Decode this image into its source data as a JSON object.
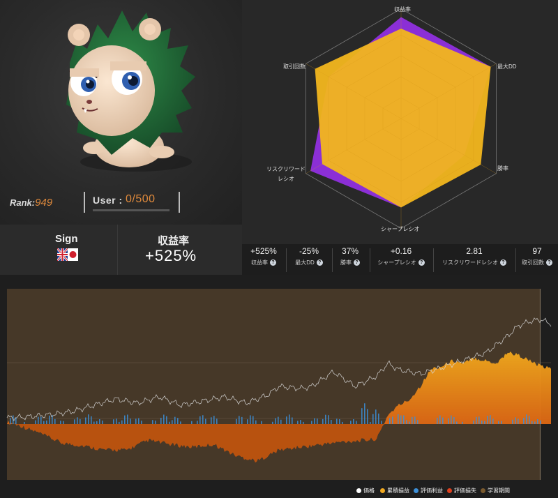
{
  "profile": {
    "rank_label": "Rank:",
    "rank_value": "949",
    "user_label": "User :",
    "user_value": "0/500",
    "avatar_icon": "lion-mascot-icon"
  },
  "sign": {
    "label": "Sign",
    "flag_icon": "gbp-jpy-flag-icon",
    "return_label": "収益率",
    "return_value": "+525%"
  },
  "radar": {
    "labels": [
      "収益率",
      "最大DD",
      "勝率",
      "シャープレシオ",
      "リスクリワードレシオ",
      "取引回数"
    ],
    "risk_reward_line1": "リスクリワード",
    "risk_reward_line2": "レシオ",
    "outer_values": [
      0.97,
      0.99,
      0.7,
      0.85,
      1.0,
      0.8
    ],
    "inner_values": [
      0.86,
      0.99,
      0.88,
      0.85,
      0.87,
      0.95
    ],
    "colors": {
      "outer": "#8b2fd6",
      "inner": "#f2b61e"
    }
  },
  "stats": [
    {
      "value": "+525%",
      "label": "収益率"
    },
    {
      "value": "-25%",
      "label": "最大DD"
    },
    {
      "value": "37%",
      "label": "勝率"
    },
    {
      "value": "+0.16",
      "label": "シャープレシオ"
    },
    {
      "value": "2.81",
      "label": "リスクリワードレシオ"
    },
    {
      "value": "97",
      "label": "取引回数"
    }
  ],
  "legend": [
    {
      "label": "価格",
      "color": "#ffffff"
    },
    {
      "label": "累積損益",
      "color": "#f0a820"
    },
    {
      "label": "評価利益",
      "color": "#3c8fd8"
    },
    {
      "label": "評価損失",
      "color": "#e0401e"
    },
    {
      "label": "学習期間",
      "color": "#7a5a2e"
    }
  ],
  "chart_data": {
    "type": "area",
    "learning_period_fraction": 0.98,
    "cumulative_pnl_knots": [
      [
        0,
        0
      ],
      [
        0.02,
        -0.02
      ],
      [
        0.06,
        -0.08
      ],
      [
        0.1,
        -0.15
      ],
      [
        0.14,
        -0.17
      ],
      [
        0.18,
        -0.2
      ],
      [
        0.22,
        -0.2
      ],
      [
        0.26,
        -0.13
      ],
      [
        0.3,
        -0.16
      ],
      [
        0.34,
        -0.18
      ],
      [
        0.38,
        -0.16
      ],
      [
        0.42,
        -0.24
      ],
      [
        0.46,
        -0.28
      ],
      [
        0.5,
        -0.2
      ],
      [
        0.54,
        -0.18
      ],
      [
        0.58,
        -0.16
      ],
      [
        0.62,
        -0.14
      ],
      [
        0.66,
        -0.13
      ],
      [
        0.68,
        -0.12
      ],
      [
        0.7,
        0.05
      ],
      [
        0.72,
        0.12
      ],
      [
        0.74,
        0.16
      ],
      [
        0.76,
        0.26
      ],
      [
        0.78,
        0.38
      ],
      [
        0.8,
        0.4
      ],
      [
        0.82,
        0.44
      ],
      [
        0.84,
        0.42
      ],
      [
        0.86,
        0.46
      ],
      [
        0.88,
        0.44
      ],
      [
        0.9,
        0.42
      ],
      [
        0.92,
        0.5
      ],
      [
        0.94,
        0.48
      ],
      [
        0.96,
        0.44
      ],
      [
        0.98,
        0.4
      ],
      [
        1.0,
        0.38
      ]
    ],
    "price_knots": [
      [
        0,
        0
      ],
      [
        0.04,
        0.01
      ],
      [
        0.08,
        0.03
      ],
      [
        0.12,
        0.06
      ],
      [
        0.16,
        0.12
      ],
      [
        0.2,
        0.18
      ],
      [
        0.24,
        0.14
      ],
      [
        0.28,
        0.2
      ],
      [
        0.32,
        0.12
      ],
      [
        0.36,
        0.16
      ],
      [
        0.4,
        0.2
      ],
      [
        0.44,
        0.14
      ],
      [
        0.48,
        0.22
      ],
      [
        0.5,
        0.3
      ],
      [
        0.54,
        0.28
      ],
      [
        0.56,
        0.3
      ],
      [
        0.6,
        0.44
      ],
      [
        0.64,
        0.3
      ],
      [
        0.68,
        0.4
      ],
      [
        0.7,
        0.52
      ],
      [
        0.72,
        0.46
      ],
      [
        0.76,
        0.42
      ],
      [
        0.8,
        0.48
      ],
      [
        0.84,
        0.55
      ],
      [
        0.88,
        0.62
      ],
      [
        0.92,
        0.78
      ],
      [
        0.94,
        0.88
      ],
      [
        0.96,
        0.92
      ],
      [
        0.98,
        0.94
      ],
      [
        1.0,
        0.9
      ]
    ]
  }
}
